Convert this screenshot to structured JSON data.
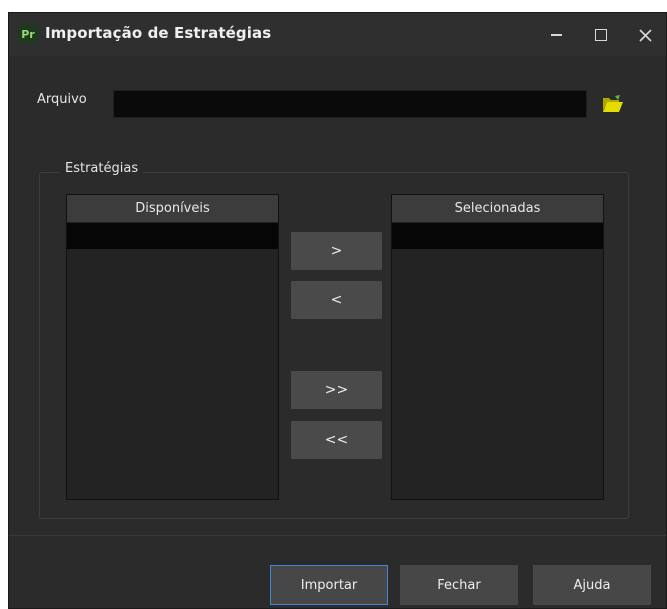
{
  "window": {
    "app_badge": "Pr",
    "title": "Importação de Estratégias"
  },
  "file": {
    "label": "Arquivo",
    "value": ""
  },
  "strategies": {
    "group_title": "Estratégias",
    "available_header": "Disponíveis",
    "selected_header": "Selecionadas"
  },
  "transfer_buttons": {
    "add_one": ">",
    "remove_one": "<",
    "add_all": ">>",
    "remove_all": "<<"
  },
  "footer": {
    "import_label": "Importar",
    "close_label": "Fechar",
    "help_label": "Ajuda"
  },
  "icons": {
    "folder": "folder-open-icon",
    "minimize": "minimize-icon",
    "maximize": "maximize-icon",
    "close": "close-icon"
  },
  "colors": {
    "window_bg": "#2b2b2b",
    "input_bg": "#0a0a0a",
    "button_bg": "#4a4a4a",
    "primary_border": "#3f87d6",
    "folder_icon": "#d4d400"
  }
}
